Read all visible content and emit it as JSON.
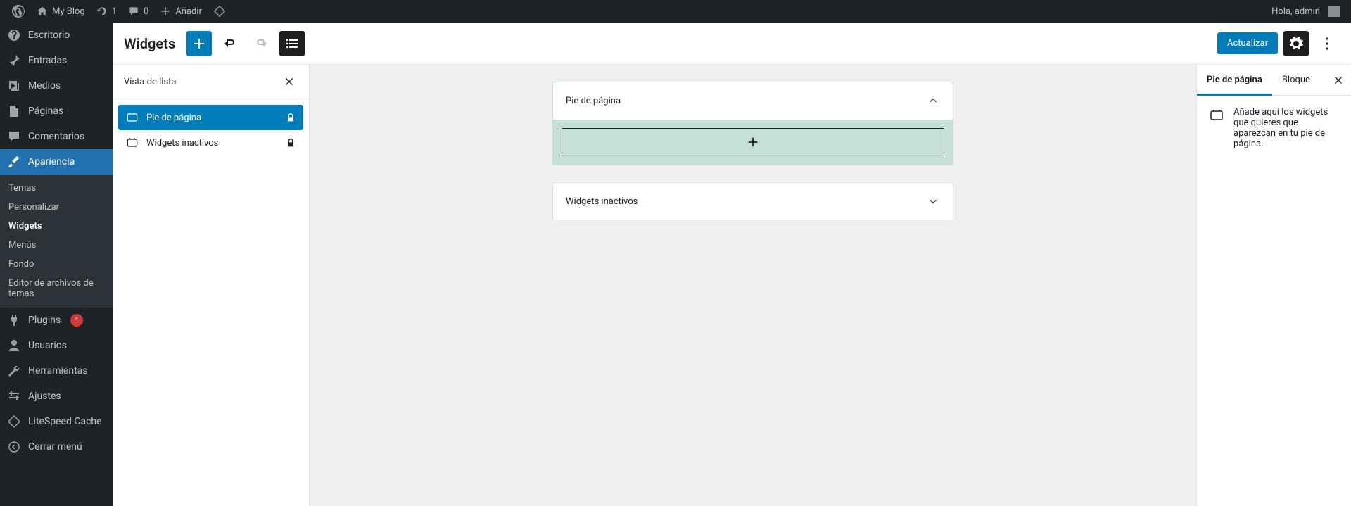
{
  "adminbar": {
    "site_name": "My Blog",
    "updates_count": "1",
    "comments_count": "0",
    "add_new": "Añadir",
    "greeting": "Hola, admin"
  },
  "adminmenu": {
    "dashboard": "Escritorio",
    "posts": "Entradas",
    "media": "Medios",
    "pages": "Páginas",
    "comments": "Comentarios",
    "appearance": "Apariencia",
    "appearance_sub": {
      "themes": "Temas",
      "customize": "Personalizar",
      "widgets": "Widgets",
      "menus": "Menús",
      "background": "Fondo",
      "theme_editor": "Editor de archivos de temas"
    },
    "plugins": "Plugins",
    "plugins_badge": "1",
    "users": "Usuarios",
    "tools": "Herramientas",
    "settings": "Ajustes",
    "litespeed": "LiteSpeed Cache",
    "collapse": "Cerrar menú"
  },
  "editor": {
    "title": "Widgets",
    "update_btn": "Actualizar",
    "listview": {
      "title": "Vista de lista",
      "items": [
        {
          "label": "Pie de página"
        },
        {
          "label": "Widgets inactivos"
        }
      ]
    },
    "canvas": {
      "area_footer": "Pie de página",
      "area_inactive": "Widgets inactivos"
    },
    "settings": {
      "tab_area": "Pie de página",
      "tab_block": "Bloque",
      "info_text": "Añade aquí los widgets que quieres que aparezcan en tu pie de página."
    }
  }
}
